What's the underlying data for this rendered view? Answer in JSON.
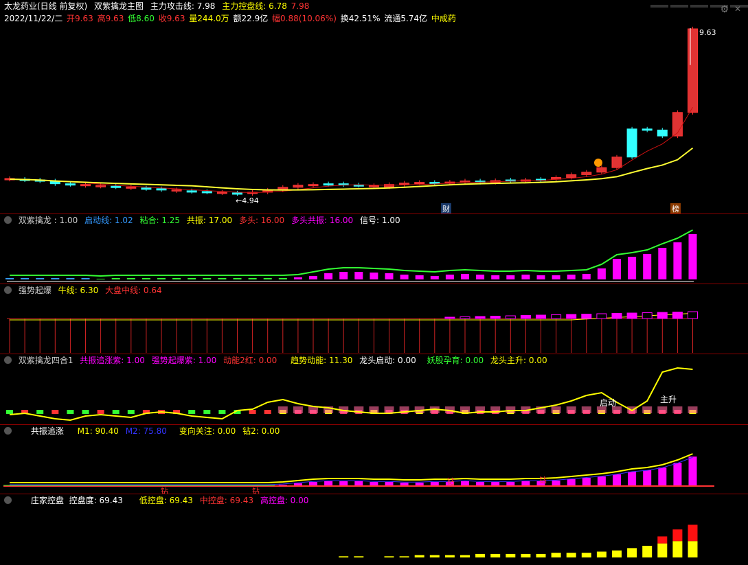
{
  "main": {
    "title": "太龙药业(日线 前复权)",
    "indicator_name": "双紫擒龙主图",
    "attack_label": "主力攻击线: 7.98",
    "control_label": "主力控盘线: 6.78",
    "control_value2": "7.98",
    "date": "2022/11/22/二",
    "open": "开9.63",
    "high": "高9.63",
    "low": "低8.60",
    "close": "收9.63",
    "volume": "量244.0万",
    "amount": "额22.9亿",
    "change": "幅0.88(10.06%)",
    "turnover": "换42.51%",
    "float": "流通5.74亿",
    "sector": "中成药",
    "high_mark": "9.63",
    "low_mark": "4.94",
    "tag_cai": "财",
    "tag_bang": "榜"
  },
  "pane1": {
    "name": "双紫擒龙",
    "v1": ": 1.00",
    "qidong": "启动线: 1.02",
    "zhanhe": "粘合: 1.25",
    "gongzhen": "共振: 17.00",
    "duotou": "多头: 16.00",
    "duotou_gz": "多头共振: 16.00",
    "xinhao": "信号: 1.00"
  },
  "pane2": {
    "name": "强势起爆",
    "niuxian": "牛线: 6.30",
    "dapan": "大盘中线: 0.64"
  },
  "pane3": {
    "name": "双紫擒龙四合1",
    "a": "共振追涨紫: 1.00",
    "b": "强势起爆紫: 1.00",
    "c": "动能2红: 0.00",
    "d": "趋势动能: 11.30",
    "e": "龙头启动: 0.00",
    "f": "妖股孕育: 0.00",
    "g": "龙头主升: 0.00",
    "lbl_qidong": "启动",
    "lbl_zhusheng": "主升"
  },
  "pane4": {
    "name": "共振追涨",
    "m1": "M1: 90.40",
    "m2": "M2: 75.80",
    "bianxiang": "变向关注: 0.00",
    "zuan": "钻2: 0.00",
    "zuan_lbl": "钻"
  },
  "pane5": {
    "name": "庄家控盘",
    "kongpan": "控盘度: 69.43",
    "di": "低控盘: 69.43",
    "zhong": "中控盘: 69.43",
    "gao": "高控盘: 0.00"
  },
  "colors": {
    "up": "#ff3333",
    "down": "#33ffff",
    "yellow": "#ffff00",
    "magenta": "#ff00ff",
    "green": "#33ff33",
    "blue": "#3399ff"
  },
  "chart_data": {
    "type": "candlestick",
    "high": 9.63,
    "low": 4.94,
    "last_close": 9.63
  }
}
